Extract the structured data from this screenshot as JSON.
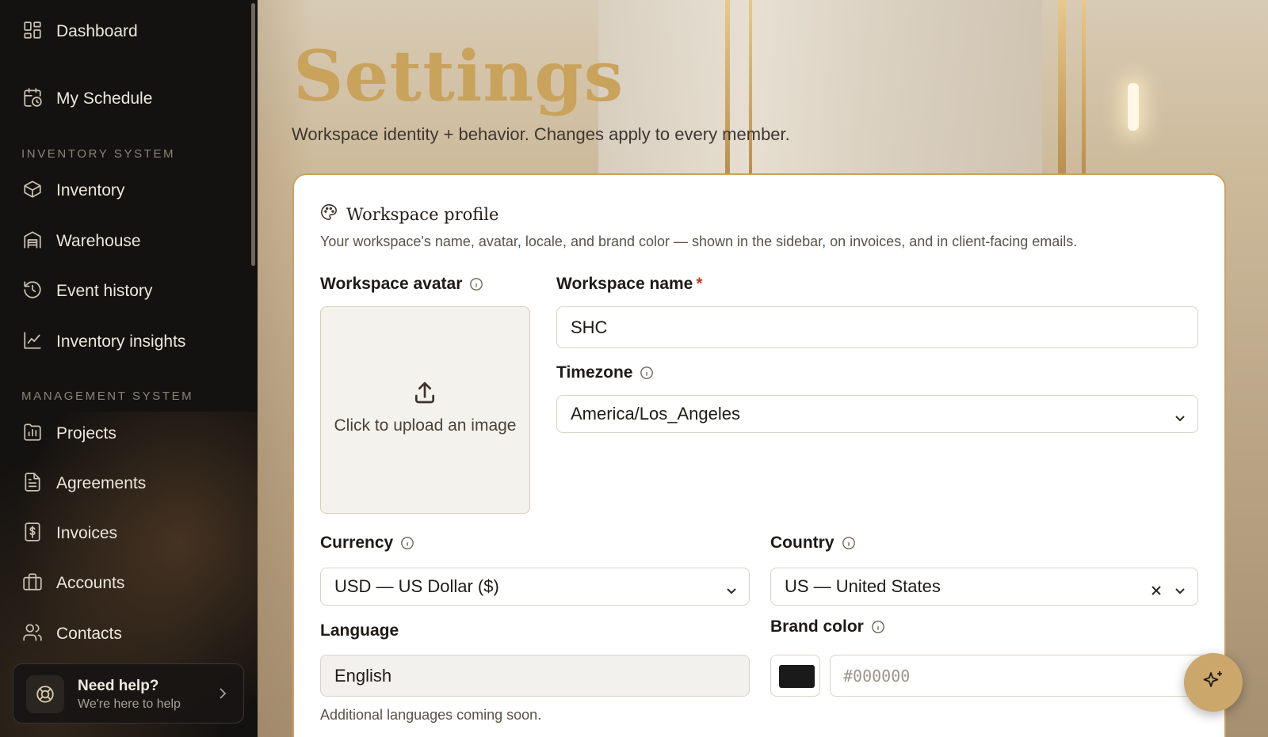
{
  "sidebar": {
    "items_top": [
      {
        "label": "Dashboard",
        "icon": "dashboard-icon"
      },
      {
        "label": "My Schedule",
        "icon": "calendar-clock-icon"
      }
    ],
    "inventory_section": "INVENTORY SYSTEM",
    "inventory_items": [
      {
        "label": "Inventory",
        "icon": "box-icon"
      },
      {
        "label": "Warehouse",
        "icon": "warehouse-icon"
      },
      {
        "label": "Event history",
        "icon": "history-icon"
      },
      {
        "label": "Inventory insights",
        "icon": "chart-line-icon"
      }
    ],
    "management_section": "MANAGEMENT SYSTEM",
    "management_items": [
      {
        "label": "Projects",
        "icon": "projects-icon"
      },
      {
        "label": "Agreements",
        "icon": "document-icon"
      },
      {
        "label": "Invoices",
        "icon": "invoice-icon"
      },
      {
        "label": "Accounts",
        "icon": "briefcase-icon"
      },
      {
        "label": "Contacts",
        "icon": "users-icon"
      }
    ],
    "help": {
      "title": "Need help?",
      "subtitle": "We're here to help"
    }
  },
  "page": {
    "title": "Settings",
    "subtitle": "Workspace identity + behavior. Changes apply to every member."
  },
  "profile": {
    "title": "Workspace profile",
    "description": "Your workspace's name, avatar, locale, and brand color — shown in the sidebar, on invoices, and in client-facing emails.",
    "avatar_label": "Workspace avatar",
    "upload_text": "Click to upload an image",
    "name_label": "Workspace name",
    "name_required": "*",
    "name_value": "SHC",
    "timezone_label": "Timezone",
    "timezone_value": "America/Los_Angeles",
    "currency_label": "Currency",
    "currency_value": "USD — US Dollar ($)",
    "country_label": "Country",
    "country_value": "US — United States",
    "language_label": "Language",
    "language_value": "English",
    "language_help": "Additional languages coming soon.",
    "brand_label": "Brand color",
    "brand_placeholder": "#000000",
    "brand_swatch": "#1a1a1a"
  },
  "colors": {
    "accent": "#c9a25c",
    "sidebar_bg": "#141210"
  }
}
